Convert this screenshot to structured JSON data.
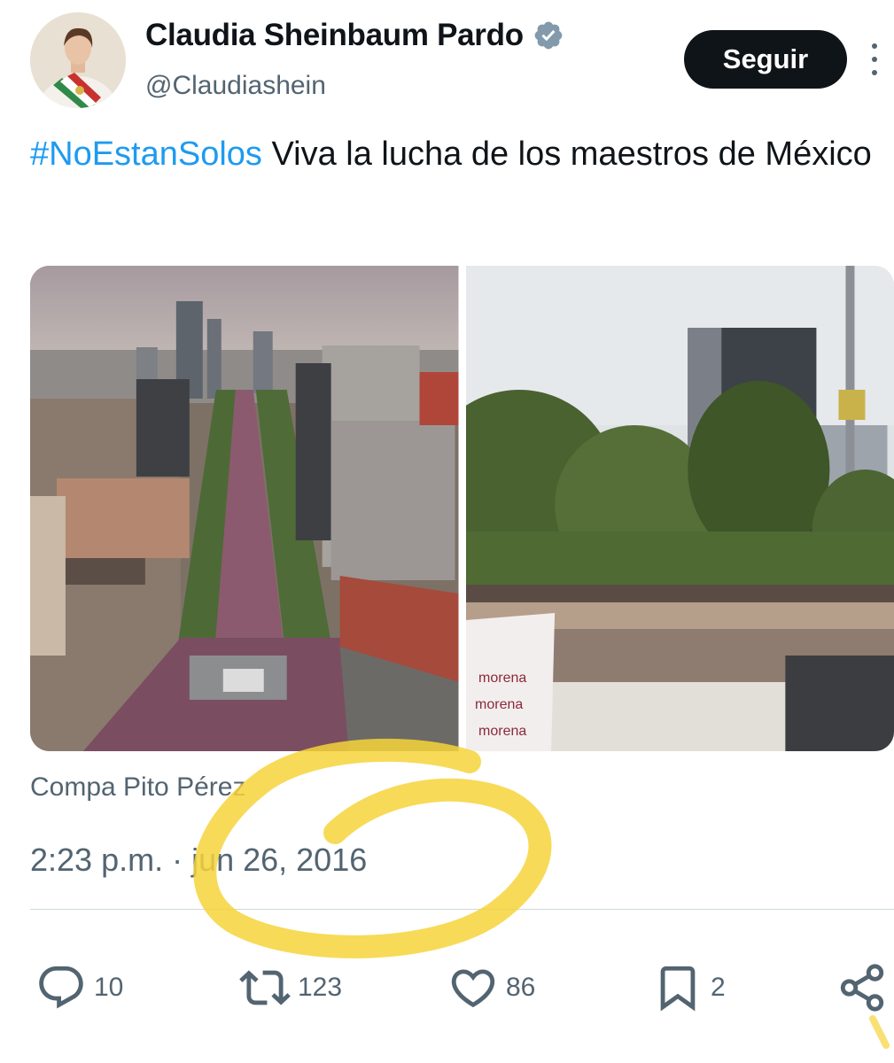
{
  "user": {
    "display_name": "Claudia Sheinbaum Pardo",
    "handle": "@Claudiashein",
    "verified_icon": "verified-badge-icon"
  },
  "follow_label": "Seguir",
  "tweet": {
    "hashtag": "#NoEstanSolos",
    "text": " Viva la lucha de los maestros de México"
  },
  "source": "Compa Pito Pérez",
  "timestamp": "2:23 p.m. · jun 26, 2016",
  "actions": {
    "replies": "10",
    "retweets": "123",
    "likes": "86",
    "bookmarks": "2"
  },
  "colors": {
    "accent": "#1d9bf0",
    "text": "#0f1419",
    "muted": "#536471",
    "highlight": "#f6d33a"
  }
}
